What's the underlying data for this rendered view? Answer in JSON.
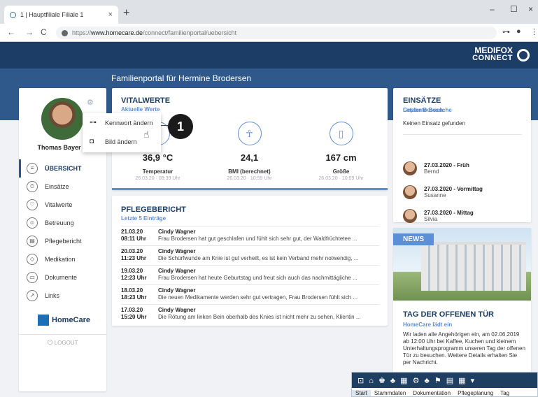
{
  "browser": {
    "tab_title": "1 | Hauptfiliale Filiale 1",
    "tab_close": "×",
    "new_tab": "+",
    "url_prefix": "https://",
    "url_host": "www.homecare.de",
    "url_path": "/connect/familienportal/uebersicht",
    "back": "←",
    "forward": "→",
    "reload": "C",
    "minimize": "–",
    "maximize": "☐",
    "close": "×",
    "key": "⊶",
    "profile": "●",
    "more": "⋮"
  },
  "brand": {
    "line1": "MEDIFOX",
    "line2": "CONNECT"
  },
  "portal_title": "Familienportal für Hermine Brodersen",
  "profile": {
    "name": "Thomas Bayer",
    "menu": [
      {
        "label": "Übersicht",
        "icon": "≡"
      },
      {
        "label": "Einsätze",
        "icon": "⏱"
      },
      {
        "label": "Vitalwerte",
        "icon": "♡"
      },
      {
        "label": "Betreuung",
        "icon": "☺"
      },
      {
        "label": "Pflegebericht",
        "icon": "▤"
      },
      {
        "label": "Medikation",
        "icon": "◇"
      },
      {
        "label": "Dokumente",
        "icon": "▭"
      },
      {
        "label": "Links",
        "icon": "↗"
      }
    ],
    "homecare_logo": "HomeCare",
    "logout": "LOGOUT"
  },
  "popup": {
    "items": [
      "Kennwort ändern",
      "Bild ändern"
    ],
    "badge": "1"
  },
  "vital": {
    "title": "VITALWERTE",
    "subtitle": "Aktuelle Werte",
    "items": [
      {
        "value": "36,9 °C",
        "label": "Temperatur",
        "date": "26.03.20 · 08:39 Uhr",
        "icon": "🌡"
      },
      {
        "value": "24,1",
        "label": "BMI (berechnet)",
        "date": "26.03.20 · 10:59 Uhr",
        "icon": "☥"
      },
      {
        "value": "167 cm",
        "label": "Größe",
        "date": "26.03.20 · 10:59 Uhr",
        "icon": "▯"
      }
    ]
  },
  "pflege": {
    "title": "PFLEGEBERICHT",
    "subtitle": "Letzte 5 Einträge",
    "rows": [
      {
        "date": "21.03.20",
        "time": "08:11 Uhr",
        "author": "Cindy Wagner",
        "text": "Frau Brodersen hat gut geschlafen und fühlt sich sehr gut, der Waldfrüchtetee ..."
      },
      {
        "date": "20.03.20",
        "time": "11:23 Uhr",
        "author": "Cindy Wagner",
        "text": "Die Schürfwunde am Knie ist gut verheilt, es ist kein Verband mehr notwendig, ..."
      },
      {
        "date": "19.03.20",
        "time": "12:23 Uhr",
        "author": "Cindy Wagner",
        "text": "Frau Brodersen hat heute Geburtstag und freut sich auch das nachmittägliche ..."
      },
      {
        "date": "18.03.20",
        "time": "18:23 Uhr",
        "author": "Cindy Wagner",
        "text": "Die neuen Medikamente werden sehr gut vertragen, Frau Brodersen fühlt sich ..."
      },
      {
        "date": "17.03.20",
        "time": "15:20 Uhr",
        "author": "Cindy Wagner",
        "text": "Die Rötung am linken Bein oberhalb des Knies ist nicht mehr zu sehen, Klientin ..."
      }
    ]
  },
  "einsatz": {
    "title": "EINSÄTZE",
    "subtitle": "Letzter Besuch",
    "none": "Keinen Einsatz gefunden",
    "planned_label": "Geplante Besuche",
    "visits": [
      {
        "title": "27.03.2020 - Früh",
        "name": "Bernd"
      },
      {
        "title": "27.03.2020 - Vormittag",
        "name": "Susanne"
      },
      {
        "title": "27.03.2020 - Mittag",
        "name": "Silvia"
      }
    ]
  },
  "news": {
    "tag": "NEWS",
    "title": "TAG DER OFFENEN TÜR",
    "subtitle": "HomeCare lädt ein",
    "text": "Wir laden alle Angehörigen ein, am 02.06.2019 ab 12:00 Uhr bei Kaffee, Kuchen und kleinem Unterhaltungsprogramm unseren Tag der offenen Tür zu besuchen. Weitere Details erhalten Sie per Nachricht."
  },
  "taskbar": {
    "icons": "⊡ ⌂ ♚ ♣ ▦ ⚙ ♣ ⚑ ▤ ▦ ▾",
    "tabs": [
      "Start",
      "Stammdaten",
      "Dokumentation",
      "Pflegeplanung",
      "Tag"
    ]
  },
  "colors": {
    "navy": "#1c3d66",
    "band": "#2f588b",
    "accent": "#5b8fd6"
  }
}
